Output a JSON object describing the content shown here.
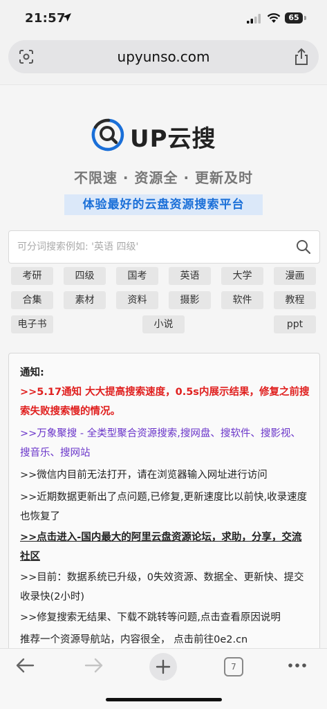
{
  "status": {
    "time": "21:57",
    "battery": "65"
  },
  "browser": {
    "url": "upyunso.com"
  },
  "site": {
    "brand": "UP云搜",
    "slogan": "不限速 · 资源全 · 更新及时",
    "subslogan": "体验最好的云盘资源搜索平台"
  },
  "search": {
    "placeholder": "可分词搜索例如: '英语 四级'",
    "value": ""
  },
  "tags": [
    "考研",
    "四级",
    "国考",
    "英语",
    "大学",
    "漫画",
    "合集",
    "素材",
    "资料",
    "摄影",
    "软件",
    "教程",
    "电子书",
    "小说",
    "ppt"
  ],
  "notice": {
    "title": "通知:",
    "items": [
      ">>5.17通知 大大提高搜索速度，0.5s内展示结果，修复之前搜索失败搜索慢的情况。",
      ">>万象聚搜 - 全类型聚合资源搜索,搜网盘、搜软件、搜影视、搜音乐、搜网站",
      ">>微信内目前无法打开，请在浏览器输入网址进行访问",
      ">>近期数据更新出了点问题,已修复,更新速度比以前快,收录速度也恢复了",
      ">>点击进入-国内最大的阿里云盘资源论坛，求助，分享，交流社区",
      ">>目前：数据系统已升级，0失效资源、数据全、更新快、提交收录快(2小时)",
      ">>修复搜索无结果、下载不跳转等问题,点击查看原因说明",
      "推荐一个资源导航站，内容很全，  点击前往0e2.cn"
    ]
  },
  "toolbar": {
    "tab_count": "7"
  },
  "colors": {
    "accent": "#1a6fd8",
    "red": "#e0201f",
    "purple": "#6a35c9"
  }
}
